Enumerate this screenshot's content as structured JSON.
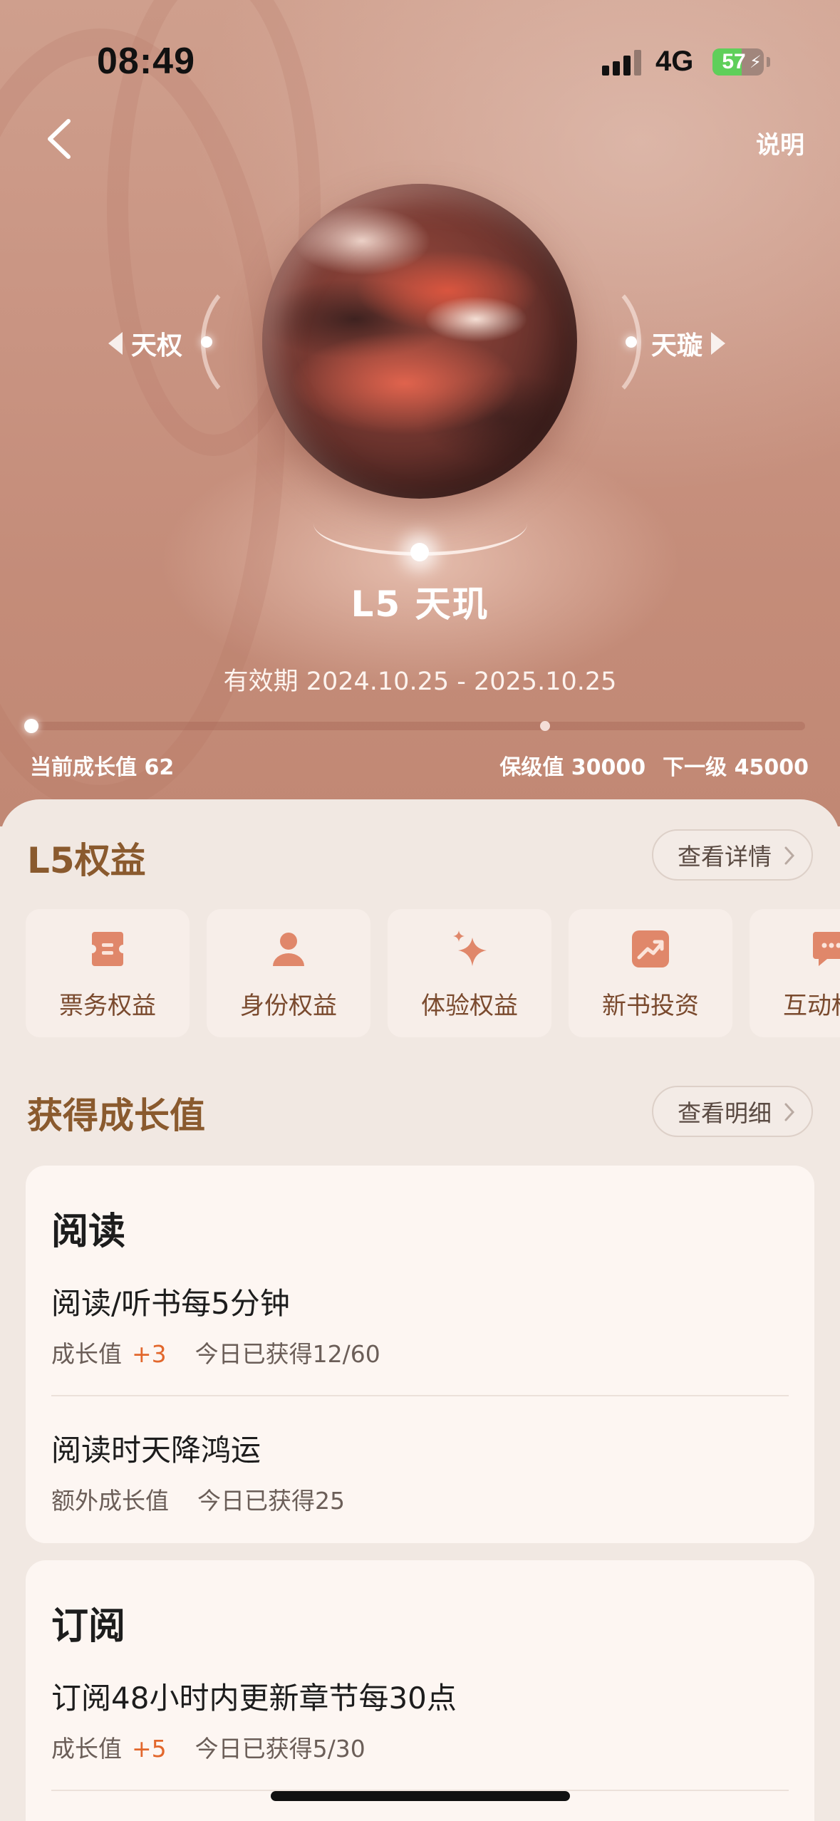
{
  "status_bar": {
    "time": "08:49",
    "network": "4G",
    "battery": "57",
    "battery_level": 0.57
  },
  "header": {
    "help_label": "说明"
  },
  "levels": {
    "prev_label": "天权",
    "next_label": "天璇",
    "current_title": "L5 天玑",
    "validity": "有效期 2024.10.25 - 2025.10.25"
  },
  "growth": {
    "current": "当前成长值 62",
    "keep": "保级值 30000",
    "next": "下一级 45000",
    "progress_fraction": 0.0014
  },
  "benefits": {
    "title": "L5权益",
    "details_label": "查看详情",
    "items": [
      {
        "label": "票务权益",
        "icon": "ticket-icon"
      },
      {
        "label": "身份权益",
        "icon": "person-icon"
      },
      {
        "label": "体验权益",
        "icon": "sparkle-icon"
      },
      {
        "label": "新书投资",
        "icon": "trend-icon"
      },
      {
        "label": "互动权益",
        "icon": "chat-icon"
      }
    ]
  },
  "earn": {
    "title": "获得成长值",
    "details_label": "查看明细",
    "groups": [
      {
        "title": "阅读",
        "tasks": [
          {
            "name": "阅读/听书每5分钟",
            "reward_label": "成长值",
            "reward_value": "+3",
            "progress": "今日已获得12/60"
          },
          {
            "name": "阅读时天降鸿运",
            "reward_label": "额外成长值",
            "reward_value": "",
            "progress": "今日已获得25"
          }
        ]
      },
      {
        "title": "订阅",
        "tasks": [
          {
            "name": "订阅48小时内更新章节每30点",
            "reward_label": "成长值",
            "reward_value": "+5",
            "progress": "今日已获得5/30"
          }
        ]
      }
    ]
  },
  "colors": {
    "accent": "#e2672c",
    "section_title": "#8a5a2e",
    "hero": "#c99482",
    "icon": "#e0876a"
  }
}
